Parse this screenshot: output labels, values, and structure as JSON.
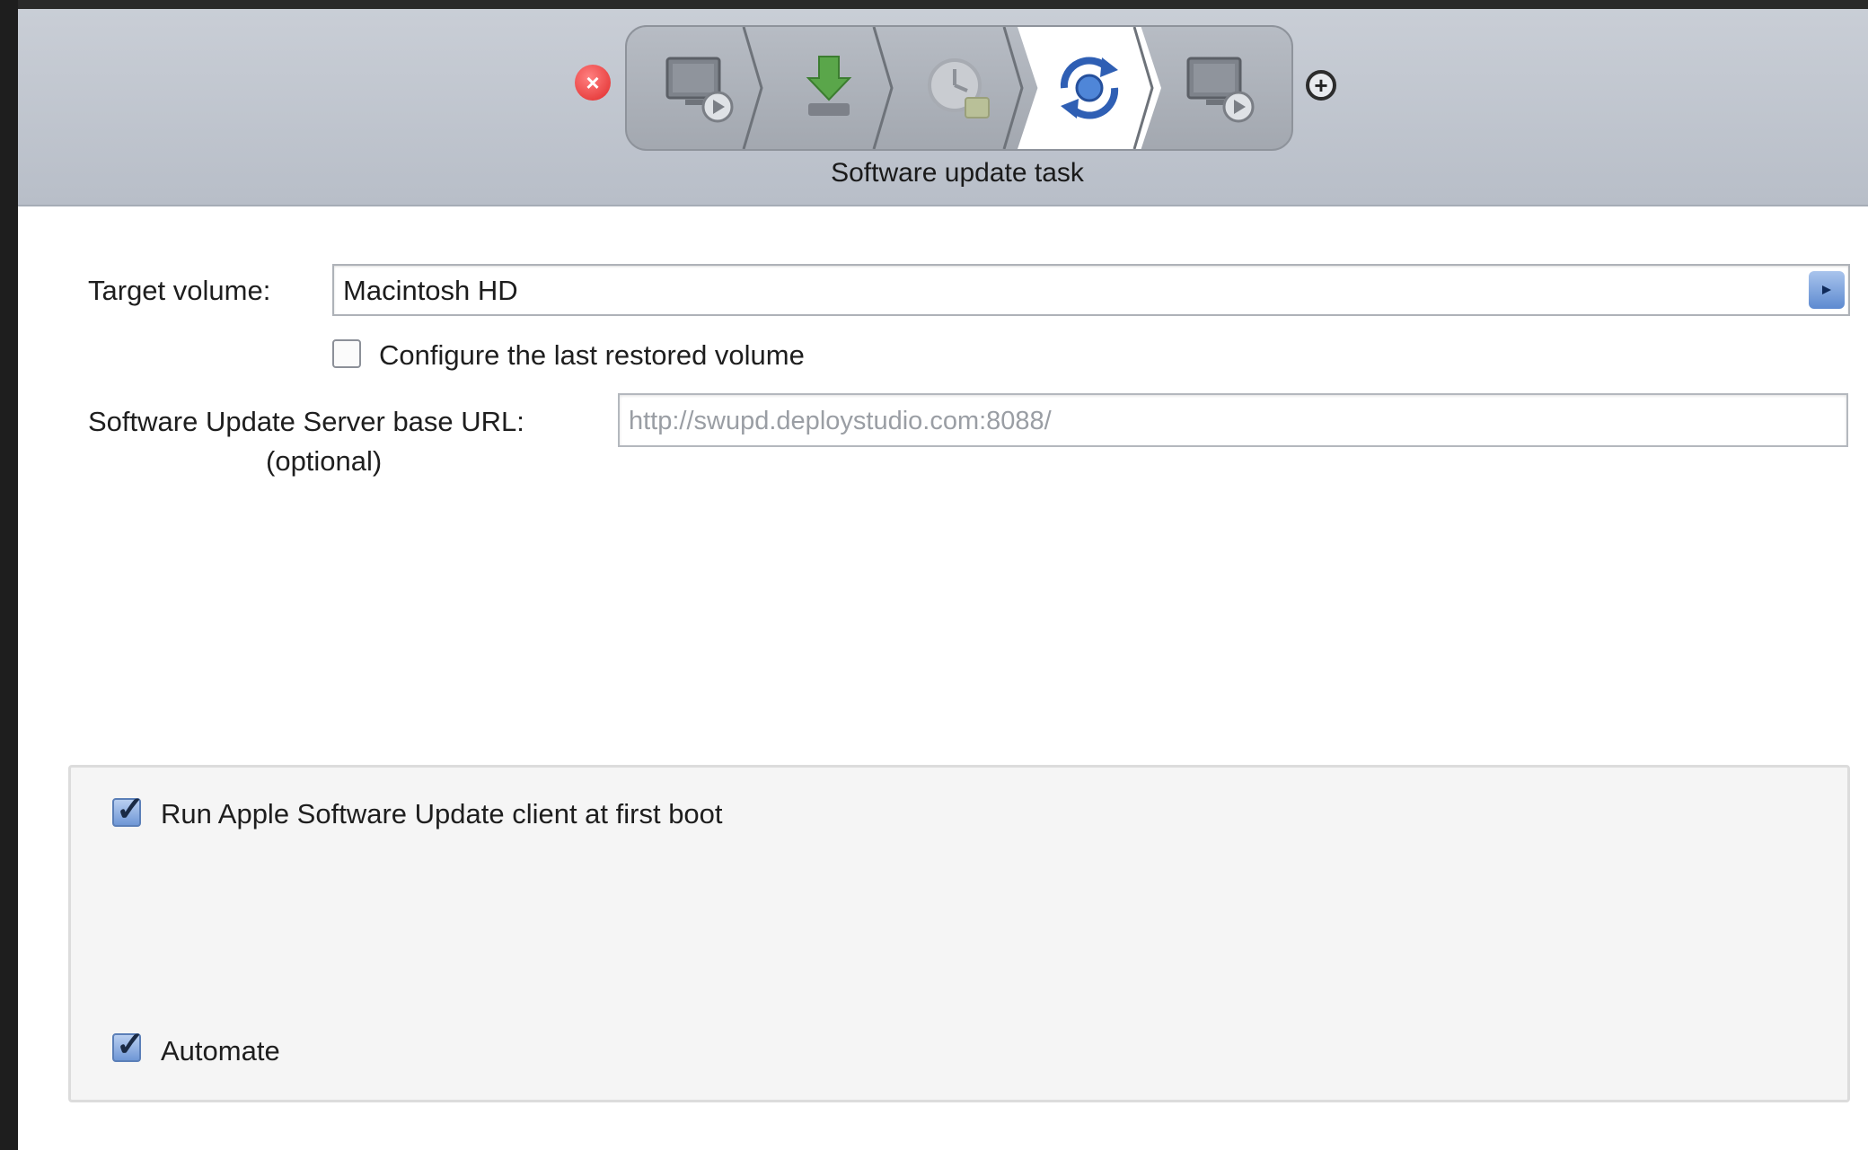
{
  "toolbar": {
    "task_title": "Software update task",
    "workflow_steps": [
      {
        "icon": "monitor-play-icon",
        "active": false
      },
      {
        "icon": "download-arrow-icon",
        "active": false
      },
      {
        "icon": "clock-disk-icon",
        "active": false
      },
      {
        "icon": "software-update-icon",
        "active": true
      },
      {
        "icon": "monitor-play-icon",
        "active": false
      }
    ]
  },
  "form": {
    "target_volume_label": "Target volume:",
    "target_volume_value": "Macintosh HD",
    "configure_last_restored_label": "Configure the last restored volume",
    "configure_last_restored_checked": false,
    "server_url_label": "Software Update Server base URL:",
    "server_url_optional": "(optional)",
    "server_url_placeholder": "http://swupd.deploystudio.com:8088/",
    "server_url_value": ""
  },
  "options": {
    "run_client_label": "Run Apple Software Update client at first boot",
    "run_client_checked": true,
    "automate_label": "Automate",
    "automate_checked": true
  },
  "colors": {
    "toolbar_bg": "#c2c7cf",
    "remove_red": "#e02a2a",
    "checkbox_blue": "#6f97d6",
    "popup_arrow_blue": "#5d8ad0"
  }
}
